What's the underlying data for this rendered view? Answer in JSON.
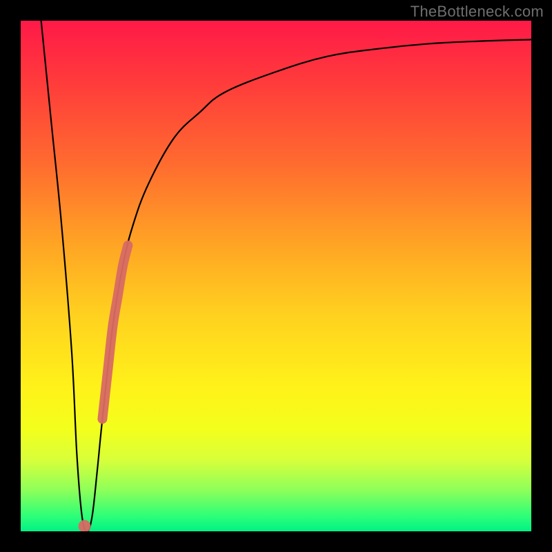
{
  "watermark": "TheBottleneck.com",
  "chart_data": {
    "type": "line",
    "title": "",
    "xlabel": "",
    "ylabel": "",
    "xlim": [
      0,
      100
    ],
    "ylim": [
      0,
      100
    ],
    "series": [
      {
        "name": "bottleneck-curve",
        "x": [
          4,
          6,
          8,
          10,
          11,
          12,
          13,
          14,
          15,
          16,
          18,
          20,
          22,
          25,
          30,
          35,
          40,
          50,
          60,
          70,
          80,
          90,
          100
        ],
        "y": [
          100,
          80,
          60,
          35,
          15,
          3,
          0,
          3,
          12,
          22,
          40,
          52,
          60,
          68,
          77,
          82,
          86,
          90,
          93,
          94.5,
          95.5,
          96,
          96.3
        ]
      },
      {
        "name": "highlight-segment",
        "x": [
          16,
          17,
          18,
          19,
          20,
          21
        ],
        "y": [
          22,
          31,
          40,
          46,
          52,
          56
        ]
      },
      {
        "name": "highlight-dot",
        "x": [
          12.5
        ],
        "y": [
          1
        ]
      }
    ]
  }
}
